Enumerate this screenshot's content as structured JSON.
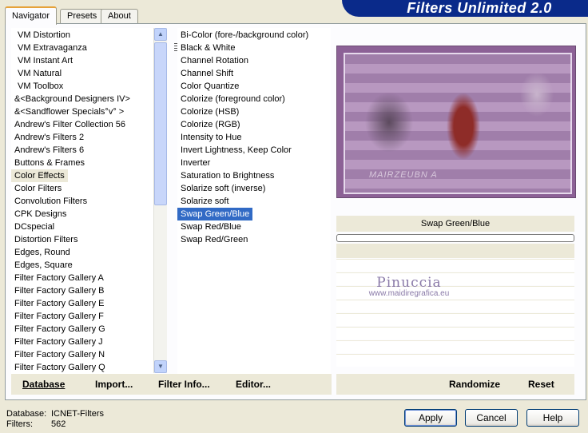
{
  "app": {
    "title": "Filters Unlimited 2.0"
  },
  "tabs": [
    {
      "label": "Navigator",
      "active": true
    },
    {
      "label": "Presets",
      "active": false
    },
    {
      "label": "About",
      "active": false
    }
  ],
  "categories": [
    "VM Distortion",
    "VM Extravaganza",
    "VM Instant Art",
    "VM Natural",
    "VM Toolbox",
    "&<Background Designers IV>",
    "&<Sandflower Specials°v° >",
    "Andrew's Filter Collection 56",
    "Andrew's Filters 2",
    "Andrew's Filters 6",
    "Buttons & Frames",
    "Color Effects",
    "Color Filters",
    "Convolution Filters",
    "CPK Designs",
    "DCspecial",
    "Distortion Filters",
    "Edges, Round",
    "Edges, Square",
    "Filter Factory Gallery A",
    "Filter Factory Gallery B",
    "Filter Factory Gallery E",
    "Filter Factory Gallery F",
    "Filter Factory Gallery G",
    "Filter Factory Gallery J",
    "Filter Factory Gallery N",
    "Filter Factory Gallery Q"
  ],
  "selected_category": "Color Effects",
  "filters": [
    "Bi-Color (fore-/background color)",
    "Black & White",
    "Channel Rotation",
    "Channel Shift",
    "Color Quantize",
    "Colorize (foreground color)",
    "Colorize (HSB)",
    "Colorize (RGB)",
    "Intensity to Hue",
    "Invert Lightness, Keep Color",
    "Inverter",
    "Saturation to Brightness",
    "Solarize soft (inverse)",
    "Solarize soft",
    "Swap Green/Blue",
    "Swap Red/Blue",
    "Swap Red/Green"
  ],
  "selected_filter": "Swap Green/Blue",
  "preview": {
    "filter_name": "Swap Green/Blue",
    "caption": "MAIRZEUBN A",
    "watermark_title": "Pinuccia",
    "watermark_url": "www.maidiregrafica.eu"
  },
  "toolbar": {
    "database": "Database",
    "import": "Import...",
    "filter_info": "Filter Info...",
    "editor": "Editor...",
    "randomize": "Randomize",
    "reset": "Reset"
  },
  "status": {
    "database_label": "Database:",
    "database_value": "ICNET-Filters",
    "filters_label": "Filters:",
    "filters_value": "562"
  },
  "dialog": {
    "apply": "Apply",
    "cancel": "Cancel",
    "help": "Help"
  },
  "colors": {
    "banner": "#0a2a8a",
    "selection": "#316ac5",
    "preview_frame": "#8c6196"
  }
}
